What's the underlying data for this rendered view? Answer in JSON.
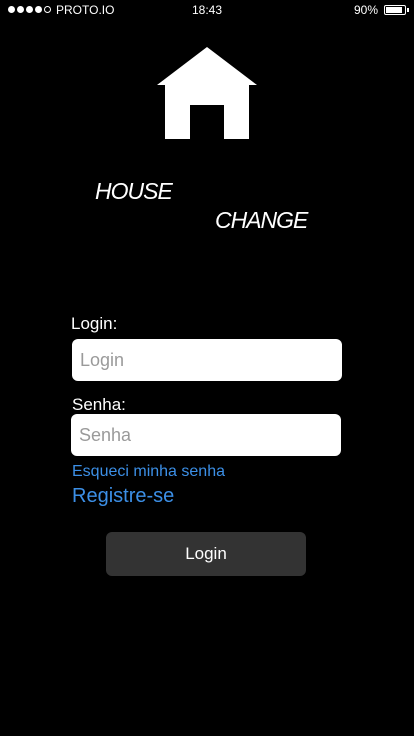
{
  "status_bar": {
    "carrier": "PROTO.IO",
    "time": "18:43",
    "battery_percent": "90%",
    "battery_level": 0.9,
    "signal_bars_filled": 4,
    "signal_bars_total": 5
  },
  "logo": {
    "icon": "house-icon",
    "word1": "HOUSE",
    "word2": "CHANGE"
  },
  "form": {
    "login_label": "Login:",
    "login_placeholder": "Login",
    "login_value": "",
    "senha_label": "Senha:",
    "senha_placeholder": "Senha",
    "senha_value": "",
    "forgot_password_link": "Esqueci minha senha",
    "register_link": "Registre-se",
    "submit_label": "Login"
  },
  "colors": {
    "background": "#000000",
    "link": "#3c8fe6",
    "button": "#333333"
  }
}
